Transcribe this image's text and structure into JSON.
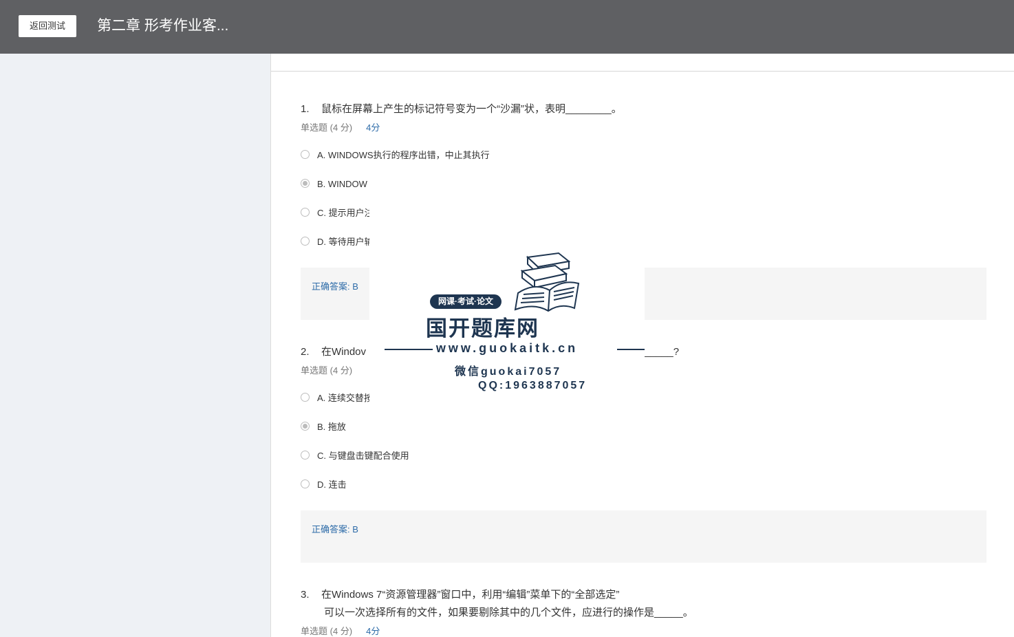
{
  "header": {
    "back_label": "返回测试",
    "title": "第二章 形考作业客..."
  },
  "questions": [
    {
      "num": "1.",
      "title": "鼠标在屏幕上产生的标记符号变为一个“沙漏”状，表明________。",
      "type": "单选题 (4 分)",
      "score": "4分",
      "options": [
        {
          "label": "A. WINDOWS执行的程序出错，中止其执行"
        },
        {
          "label": "B. WINDOW"
        },
        {
          "label": "C. 提示用户注"
        },
        {
          "label": "D. 等待用户输"
        }
      ],
      "selected_index": 1,
      "answer": "正确答案: B"
    },
    {
      "num": "2.",
      "title_start": "在Windov",
      "title_end": "_____?",
      "type": "单选题 (4 分)",
      "options": [
        {
          "label": "A. 连续交替按"
        },
        {
          "label": "B. 拖放"
        },
        {
          "label": "C. 与键盘击键配合使用"
        },
        {
          "label": "D. 连击"
        }
      ],
      "selected_index": 1,
      "answer": "正确答案: B"
    },
    {
      "num": "3.",
      "title_line1": "在Windows 7“资源管理器”窗口中，利用“编辑”菜单下的“全部选定”",
      "title_line2": "可以一次选择所有的文件，如果要剔除其中的几个文件，应进行的操作是_____。",
      "type": "单选题 (4 分)",
      "score": "4分"
    }
  ],
  "watermark": {
    "tagline": "网课·考试·论文",
    "name": "国开题库网",
    "site": "www.guokaitk.cn",
    "wechat": "微信guokai7057",
    "qq": "QQ:1963887057",
    "accent_color": "#1e3550"
  }
}
